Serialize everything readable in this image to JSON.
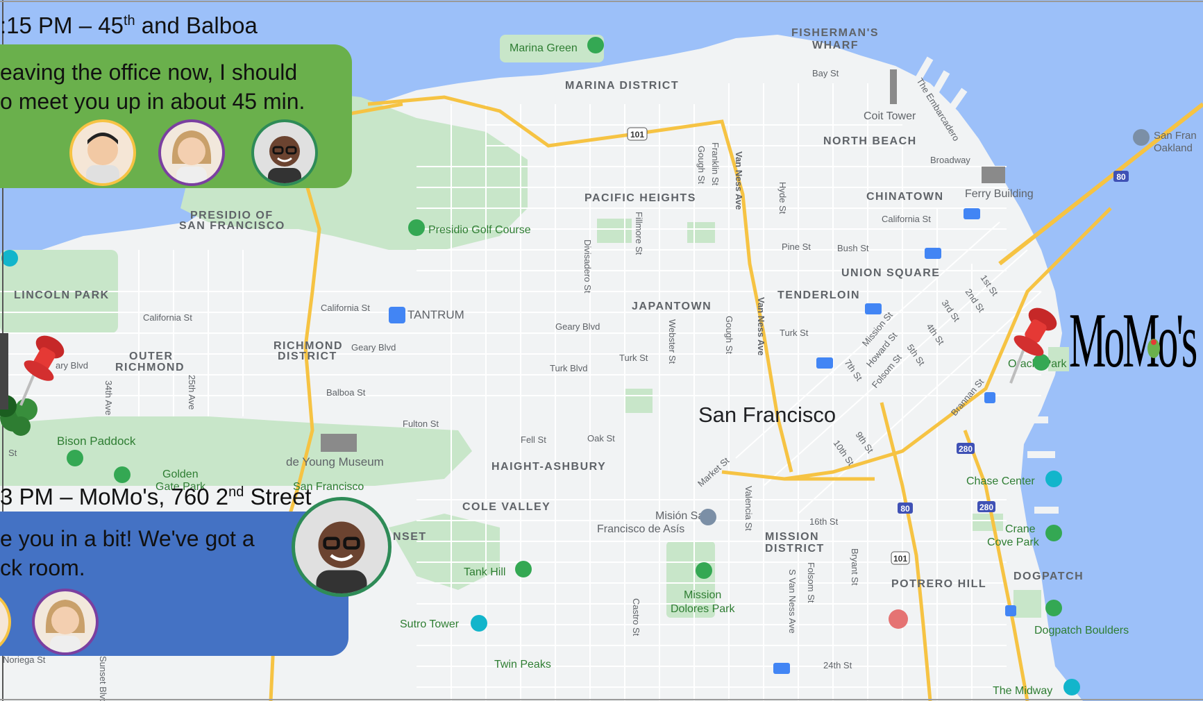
{
  "map": {
    "districts": [
      "MARINA DISTRICT",
      "FISHERMAN'S WHARF",
      "NORTH BEACH",
      "CHINATOWN",
      "PACIFIC HEIGHTS",
      "PRESIDIO OF SAN FRANCISCO",
      "LINCOLN PARK",
      "OUTER RICHMOND",
      "RICHMOND DISTRICT",
      "JAPANTOWN",
      "UNION SQUARE",
      "TENDERLOIN",
      "HAIGHT-ASHBURY",
      "COLE VALLEY",
      "MISSION DISTRICT",
      "POTRERO HILL",
      "DOGPATCH"
    ],
    "places": [
      "Marina Green",
      "Coit Tower",
      "Ferry Building",
      "Presidio Golf Course",
      "TANTRUM",
      "de Young Museum",
      "San Francisco Botanical Garden",
      "Golden Gate Park",
      "Bison Paddock",
      "Oracle Park",
      "Chase Center",
      "Crane Cove Park",
      "Dogpatch Boulders",
      "Misión San Francisco de Asís",
      "Mission Dolores Park",
      "Tank Hill",
      "Sutro Tower",
      "Twin Peaks",
      "The Midway",
      "San Francisco-Oakland"
    ],
    "city_label": "San Francisco",
    "streets": [
      "Bay St",
      "Broadway",
      "California St",
      "Pine St",
      "Bush St",
      "Geary Blvd",
      "Turk Blvd",
      "Turk St",
      "Balboa St",
      "Fulton St",
      "Fell St",
      "Oak St",
      "Market St",
      "16th St",
      "24th St",
      "Van Ness Ave",
      "Gough St",
      "Franklin St",
      "Hyde St",
      "Divisadero St",
      "Fillmore St",
      "Webster St",
      "Valencia St",
      "Bryant St",
      "Folsom St",
      "S Van Ness Ave",
      "Castro St",
      "The Embarcadero",
      "1st St",
      "2nd St",
      "3rd St",
      "4th St",
      "5th St",
      "7th St",
      "9th St",
      "10th St",
      "Mission St",
      "Howard St",
      "Folsom St",
      "Brannan St",
      "34th Ave",
      "25th Ave",
      "Noriega St",
      "Sunset Blvd"
    ],
    "highway_shields": [
      "101",
      "80",
      "280"
    ]
  },
  "message_top": {
    "time": ":15 PM – 45",
    "time_sup": "th",
    "place": " and Balboa",
    "line1": "eaving the office now, I should",
    "line2": "o meet you up in about 45 min."
  },
  "message_bottom": {
    "time": "3 PM – MoMo's, 760 2",
    "time_sup": "nd",
    "place": " Street",
    "line1": "e you in a bit!  We've got a",
    "line2": "ck room."
  },
  "logo_text": "MoMo's",
  "colors": {
    "water": "#9cc0f9",
    "land": "#f1f3f4",
    "park": "#c8e6c9",
    "highway": "#f6c343",
    "green_box": "#6ab04c",
    "blue_box": "#4472c4",
    "pin_red": "#e53935"
  }
}
